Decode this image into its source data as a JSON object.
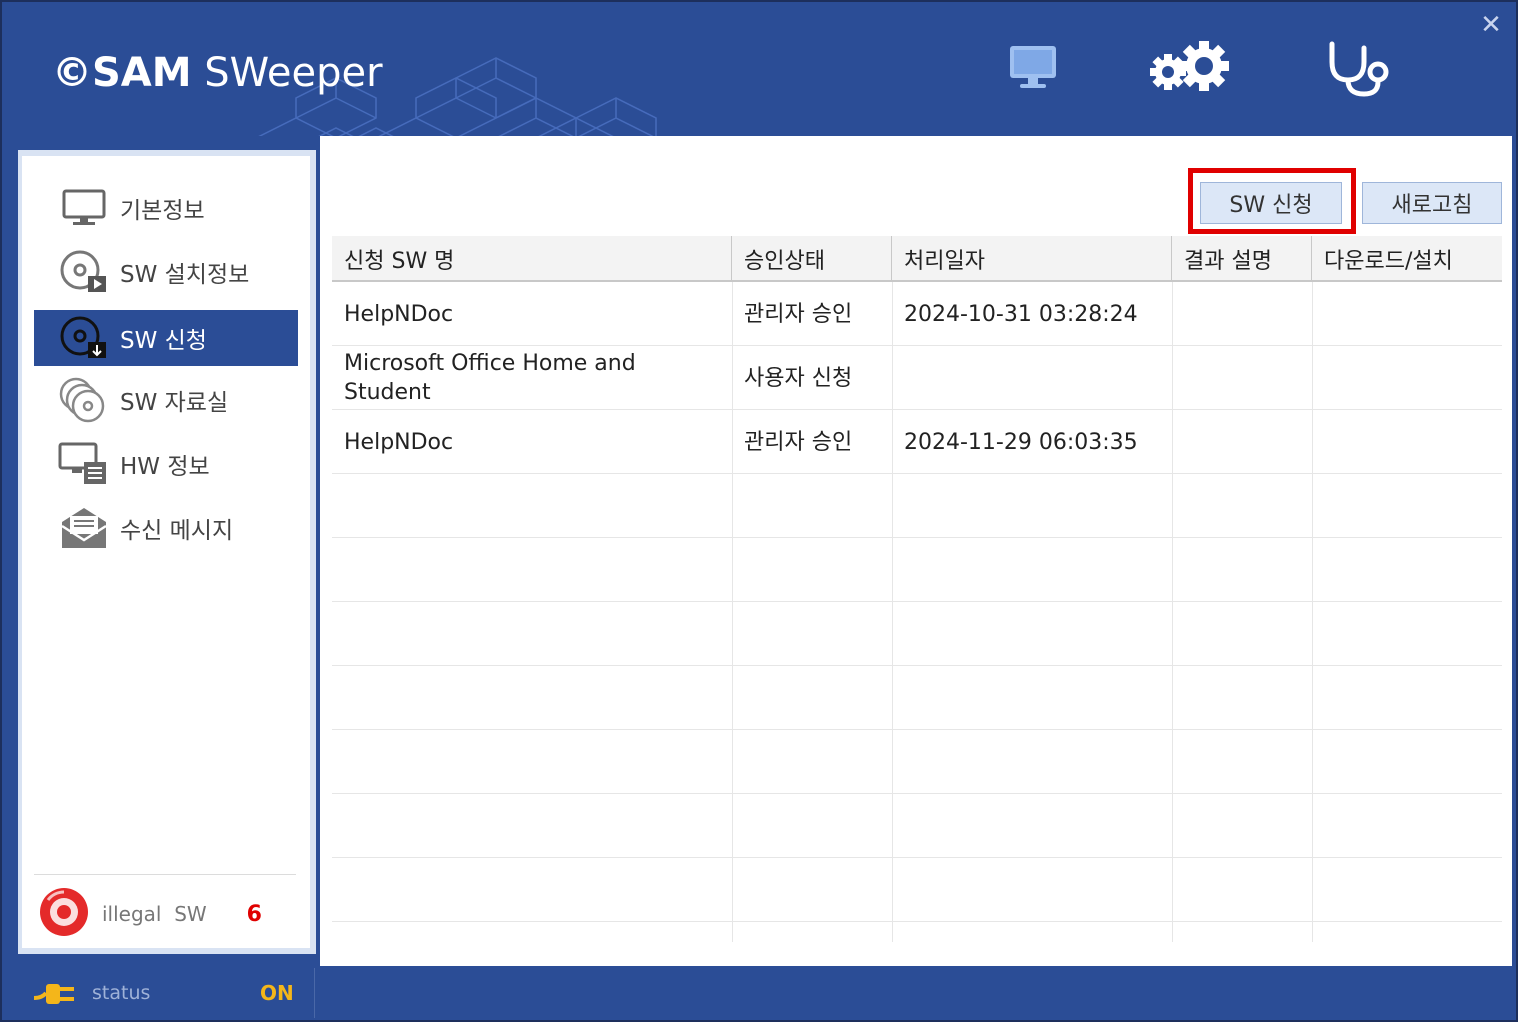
{
  "app": {
    "logo_brand": "©SAM",
    "logo_product": " SWeeper",
    "close_glyph": "✕"
  },
  "header_icons": [
    "monitor-icon",
    "gears-icon",
    "stethoscope-icon"
  ],
  "sidebar": {
    "items": [
      {
        "label": "기본정보",
        "icon": "monitor-icon",
        "active": false
      },
      {
        "label": "SW 설치정보",
        "icon": "disc-play-icon",
        "active": false
      },
      {
        "label": "SW 신청",
        "icon": "disc-download-icon",
        "active": true
      },
      {
        "label": "SW 자료실",
        "icon": "discs-stack-icon",
        "active": false
      },
      {
        "label": "HW 정보",
        "icon": "computer-list-icon",
        "active": false
      },
      {
        "label": "수신 메시지",
        "icon": "envelope-icon",
        "active": false
      }
    ],
    "illegal_label": "illegal  SW",
    "illegal_count": "6"
  },
  "toolbar": {
    "request_button": "SW 신청",
    "refresh_button": "새로고침"
  },
  "table": {
    "columns": [
      "신청 SW 명",
      "승인상태",
      "처리일자",
      "결과 설명",
      "다운로드/설치"
    ],
    "rows": [
      [
        "HelpNDoc",
        "관리자 승인",
        "2024-10-31 03:28:24",
        "",
        ""
      ],
      [
        "Microsoft Office Home and Student",
        "사용자 신청",
        "",
        "",
        ""
      ],
      [
        "HelpNDoc",
        "관리자 승인",
        "2024-11-29 06:03:35",
        "",
        ""
      ]
    ]
  },
  "status": {
    "label": "status",
    "value": "ON"
  },
  "colors": {
    "primary": "#2b4d96",
    "highlight": "#e00000",
    "status_on": "#f4b61a"
  }
}
